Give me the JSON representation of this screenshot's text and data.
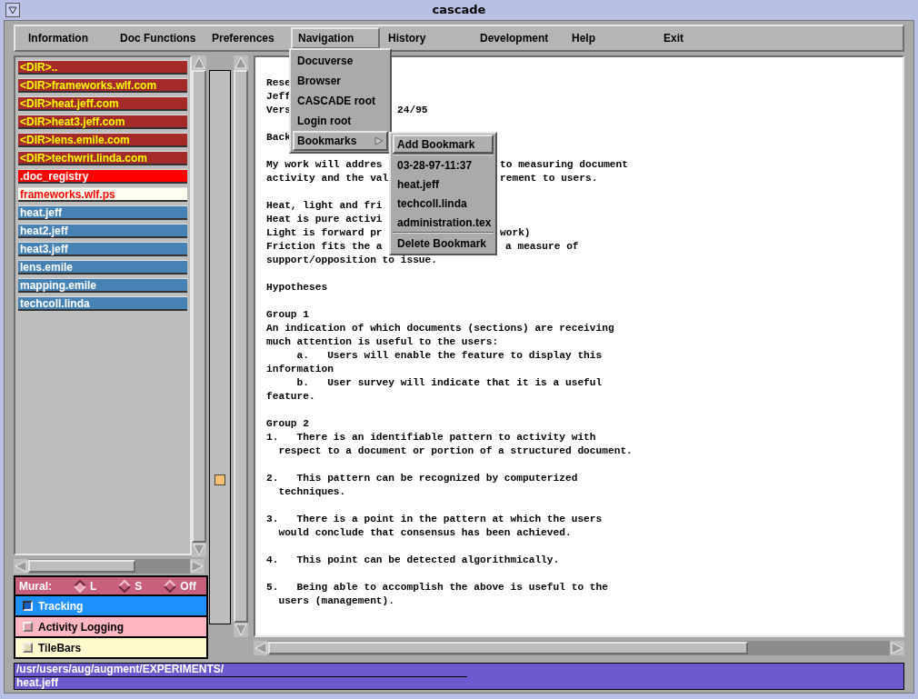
{
  "window": {
    "title": "cascade"
  },
  "menubar": [
    {
      "label": "Information",
      "selected": false
    },
    {
      "label": "Doc Functions",
      "selected": false
    },
    {
      "label": "Preferences",
      "selected": false
    },
    {
      "label": "Navigation",
      "selected": true
    },
    {
      "label": "History",
      "selected": false
    },
    {
      "label": "Development",
      "selected": false
    },
    {
      "label": "Help",
      "selected": false
    },
    {
      "label": "Exit",
      "selected": false
    }
  ],
  "navigation_menu": [
    {
      "label": "Docuverse",
      "selected": false,
      "submenu": false
    },
    {
      "label": "Browser",
      "selected": false,
      "submenu": false
    },
    {
      "label": "CASCADE root",
      "selected": false,
      "submenu": false
    },
    {
      "label": "Login root",
      "selected": false,
      "submenu": false
    },
    {
      "label": "Bookmarks",
      "selected": true,
      "submenu": true
    }
  ],
  "bookmarks_menu": [
    {
      "kind": "item",
      "label": "Add Bookmark",
      "selected": true
    },
    {
      "kind": "separator"
    },
    {
      "kind": "item",
      "label": "03-28-97-11:37",
      "selected": false
    },
    {
      "kind": "item",
      "label": "heat.jeff",
      "selected": false
    },
    {
      "kind": "item",
      "label": "techcoll.linda",
      "selected": false
    },
    {
      "kind": "item",
      "label": "administration.tex",
      "selected": false
    },
    {
      "kind": "separator"
    },
    {
      "kind": "item",
      "label": "Delete Bookmark",
      "selected": false
    }
  ],
  "files": [
    {
      "kind": "dir",
      "label": "<DIR>.."
    },
    {
      "kind": "dir",
      "label": "<DIR>frameworks.wlf.com"
    },
    {
      "kind": "dir",
      "label": "<DIR>heat.jeff.com"
    },
    {
      "kind": "dir",
      "label": "<DIR>heat3.jeff.com"
    },
    {
      "kind": "dir",
      "label": "<DIR>lens.emile.com"
    },
    {
      "kind": "dir",
      "label": "<DIR>techwrit.linda.com"
    },
    {
      "kind": "registry",
      "label": ".doc_registry"
    },
    {
      "kind": "current",
      "label": "frameworks.wlf.ps"
    },
    {
      "kind": "file",
      "label": "heat.jeff"
    },
    {
      "kind": "file",
      "label": "heat2.jeff"
    },
    {
      "kind": "file",
      "label": "heat3.jeff"
    },
    {
      "kind": "file",
      "label": "lens.emile"
    },
    {
      "kind": "file",
      "label": "mapping.emile"
    },
    {
      "kind": "file",
      "label": "techcoll.linda"
    }
  ],
  "mural": {
    "label": "Mural:",
    "options": [
      {
        "label": "L",
        "selected": true
      },
      {
        "label": "S",
        "selected": false
      },
      {
        "label": "Off",
        "selected": false
      }
    ]
  },
  "toggles": [
    {
      "label": "Tracking",
      "checked": true
    },
    {
      "label": "Activity Logging",
      "checked": false
    },
    {
      "label": "TileBars",
      "checked": false
    }
  ],
  "document": [
    {
      "kind": "text",
      "left": "Rese"
    },
    {
      "kind": "text",
      "left": "Jeff"
    },
    {
      "kind": "text",
      "left": "Vers",
      "right": "24/95"
    },
    {
      "kind": "blank"
    },
    {
      "kind": "text",
      "left": "Back"
    },
    {
      "kind": "blank"
    },
    {
      "kind": "text",
      "left": "My work will addres",
      "right": "to measuring document"
    },
    {
      "kind": "text",
      "left": "activity and the val",
      "right": "rement to users."
    },
    {
      "kind": "blank"
    },
    {
      "kind": "text",
      "left": "Heat, light and fri"
    },
    {
      "kind": "text",
      "left": "Heat is pure activi"
    },
    {
      "kind": "text",
      "left": "Light is forward pr",
      "right": "work)"
    },
    {
      "kind": "text",
      "left": "Friction fits the a",
      "right": "a measure of"
    },
    {
      "kind": "text",
      "left": "support/opposition to issue."
    },
    {
      "kind": "blank"
    },
    {
      "kind": "text",
      "left": "Hypotheses"
    },
    {
      "kind": "blank"
    },
    {
      "kind": "text",
      "left": "Group 1"
    },
    {
      "kind": "text",
      "left": "An indication of which documents (sections) are receiving"
    },
    {
      "kind": "text",
      "left": "much attention is useful to the users:"
    },
    {
      "kind": "text",
      "left": "     a.   Users will enable the feature to display this"
    },
    {
      "kind": "text",
      "left": "information"
    },
    {
      "kind": "text",
      "left": "     b.   User survey will indicate that it is a useful"
    },
    {
      "kind": "text",
      "left": "feature."
    },
    {
      "kind": "blank"
    },
    {
      "kind": "text",
      "left": "Group 2"
    },
    {
      "kind": "text",
      "left": "1.   There is an identifiable pattern to activity with"
    },
    {
      "kind": "text",
      "left": "  respect to a document or portion of a structured document."
    },
    {
      "kind": "blank"
    },
    {
      "kind": "text",
      "left": "2.   This pattern can be recognized by computerized"
    },
    {
      "kind": "text",
      "left": "  techniques."
    },
    {
      "kind": "blank"
    },
    {
      "kind": "text",
      "left": "3.   There is a point in the pattern at which the users"
    },
    {
      "kind": "text",
      "left": "  would conclude that consensus has been achieved."
    },
    {
      "kind": "blank"
    },
    {
      "kind": "text",
      "left": "4.   This point can be detected algorithmically."
    },
    {
      "kind": "blank"
    },
    {
      "kind": "text",
      "left": "5.   Being able to accomplish the above is useful to the"
    },
    {
      "kind": "text",
      "left": "  users (management)."
    }
  ],
  "status_bar": {
    "path": "/usr/users/aug/augment/EXPERIMENTS/",
    "file": "heat.jeff"
  }
}
